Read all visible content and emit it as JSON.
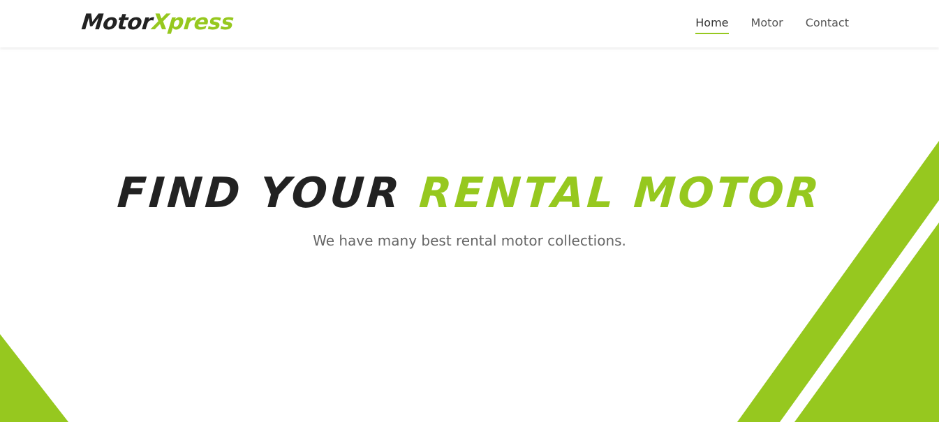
{
  "brand": {
    "part1": "Motor",
    "part2": "Xpress"
  },
  "nav": {
    "items": [
      {
        "label": "Home"
      },
      {
        "label": "Motor"
      },
      {
        "label": "Contact"
      }
    ],
    "active": "Home"
  },
  "hero": {
    "title_part1": "FIND YOUR",
    "title_part2": "RENTAL MOTOR",
    "subtitle": "We have many best rental motor collections."
  },
  "colors": {
    "accent": "#96c81f",
    "text_dark": "#222222",
    "text_muted": "#666666",
    "background": "#ffffff"
  }
}
